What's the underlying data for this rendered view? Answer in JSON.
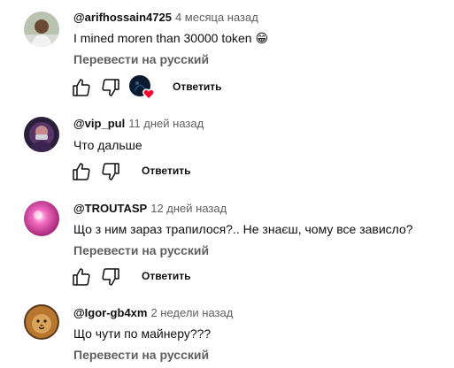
{
  "comments": [
    {
      "author": "@arifhossain4725",
      "time": "4 месяца назад",
      "text": "I mined moren than 30000 token",
      "emoji": "😁",
      "translate": "Перевести на русский",
      "reply": "Ответить",
      "has_creator_heart": true
    },
    {
      "author": "@vip_pul",
      "time": "11 дней назад",
      "text": "Что дальше",
      "reply": "Ответить"
    },
    {
      "author": "@TROUTASP",
      "time": "12 дней назад",
      "text": "Що з ним зараз трапилося?.. Не знаєш, чому все зависло?",
      "translate": "Перевести на русский",
      "reply": "Ответить"
    },
    {
      "author": "@Igor-gb4xm",
      "time": "2 недели назад",
      "text": "Що чути по майнеру???",
      "translate": "Перевести на русский"
    }
  ],
  "icons": {
    "like": "thumb-up-icon",
    "dislike": "thumb-down-icon",
    "heart": "creator-heart-icon"
  },
  "colors": {
    "heart": "#ff0033",
    "secondary_text": "#606060"
  }
}
